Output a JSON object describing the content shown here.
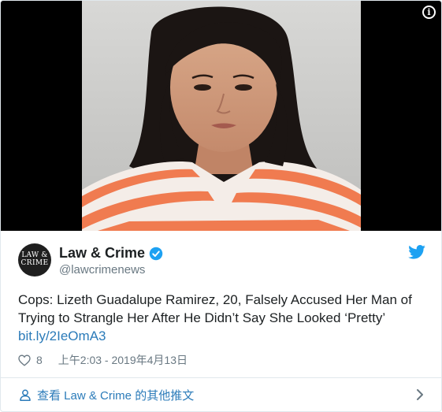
{
  "tweet": {
    "author_name": "Law & Crime",
    "author_handle": "@lawcrimenews",
    "avatar_text": [
      "LAW &",
      "CRIME"
    ],
    "text": "Cops: Lizeth Guadalupe Ramirez, 20, Falsely Accused Her Man of Trying to Strangle Her After He Didn’t Say She Looked ‘Pretty’",
    "link": "bit.ly/2IeOmA3",
    "likes": "8",
    "timestamp": "上午2:03 - 2019年4月13日"
  },
  "footer": {
    "label": "查看 Law & Crime 的其他推文"
  },
  "colors": {
    "link": "#2b7bb9",
    "verified": "#1da1f2",
    "muted": "#697882",
    "shirt_orange": "#f07b50"
  },
  "icons": [
    "info-icon",
    "verified-badge-icon",
    "twitter-bird-icon",
    "heart-icon",
    "person-icon",
    "chevron-right-icon"
  ]
}
